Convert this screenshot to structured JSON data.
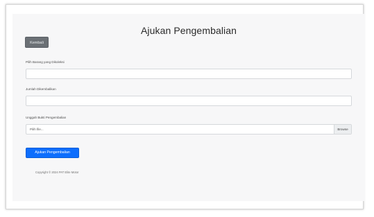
{
  "page": {
    "title": "Ajukan Pengembalian"
  },
  "buttons": {
    "back_label": "Kembali",
    "submit_label": "Ajukan Pengembalian"
  },
  "form": {
    "field_item_label": "Pilih Barang yang Dikoleksi",
    "field_amount_label": "Jumlah Dikembalikan",
    "field_proof_label": "Unggah Bukti Pengembalian",
    "file_placeholder": "Pilih file...",
    "browse_label": "Browse"
  },
  "footer": {
    "copyright": "Copyright © 2024 PAT Elite Motor"
  }
}
